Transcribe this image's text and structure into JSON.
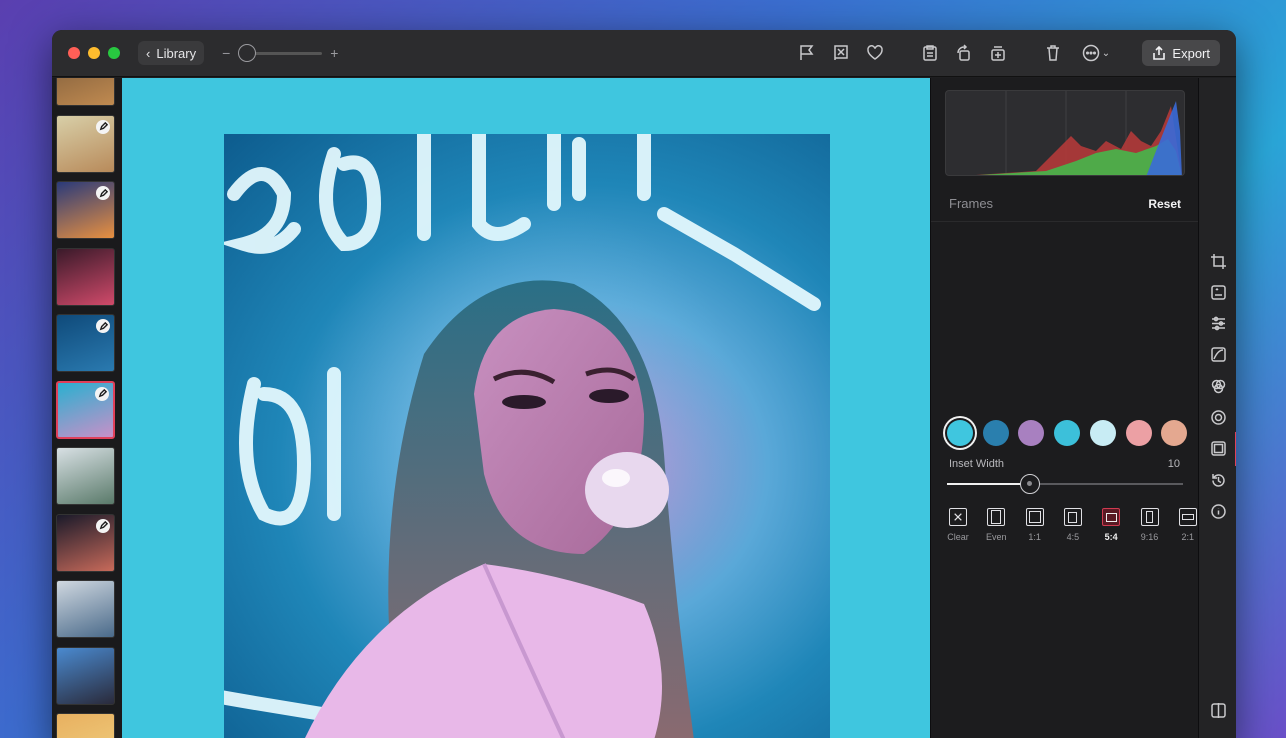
{
  "toolbar": {
    "back_label": "Library",
    "zoom_minus": "−",
    "zoom_plus": "+",
    "export_label": "Export",
    "icons": [
      "flag-icon",
      "reject-icon",
      "heart-icon",
      "clipboard-icon",
      "rotate-icon",
      "duplicate-icon",
      "trash-icon",
      "more-icon"
    ]
  },
  "filmstrip": {
    "thumbs": [
      {
        "colors": [
          "#7a5a3a",
          "#c08a50"
        ],
        "edited": false,
        "selected": false
      },
      {
        "colors": [
          "#d8cfa8",
          "#b88a5a"
        ],
        "edited": true,
        "selected": false
      },
      {
        "colors": [
          "#2a3a7a",
          "#e89040"
        ],
        "edited": true,
        "selected": false
      },
      {
        "colors": [
          "#3a1a2a",
          "#d04a6a"
        ],
        "edited": false,
        "selected": false
      },
      {
        "colors": [
          "#0f4a7a",
          "#2a7ab0"
        ],
        "edited": true,
        "selected": false
      },
      {
        "colors": [
          "#2ab0d0",
          "#c890c8"
        ],
        "edited": true,
        "selected": true
      },
      {
        "colors": [
          "#d8e0e4",
          "#5a7a6a"
        ],
        "edited": false,
        "selected": false
      },
      {
        "colors": [
          "#1a1a2a",
          "#c86a5a"
        ],
        "edited": true,
        "selected": false
      },
      {
        "colors": [
          "#d0d8e0",
          "#4a6a8a"
        ],
        "edited": false,
        "selected": false
      },
      {
        "colors": [
          "#4a8ad0",
          "#2a2a3a"
        ],
        "edited": false,
        "selected": false
      },
      {
        "colors": [
          "#e8b060",
          "#f0d080"
        ],
        "edited": false,
        "selected": false
      }
    ]
  },
  "canvas": {
    "background": "#3fc6df"
  },
  "inspector": {
    "section_title": "Frames",
    "reset_label": "Reset",
    "swatches": [
      "#3fc6df",
      "#2a7fae",
      "#a880c0",
      "#3cc0da",
      "#c8ecf4",
      "#eca0a4",
      "#e4a890"
    ],
    "selected_swatch": 0,
    "slider": {
      "label": "Inset Width",
      "value": "10",
      "fraction": 0.35
    },
    "ratios": [
      {
        "label": "Clear",
        "icon": "clear-frame-icon"
      },
      {
        "label": "Even",
        "icon": "even-frame-icon"
      },
      {
        "label": "1:1",
        "icon": "ratio-1-1-icon"
      },
      {
        "label": "4:5",
        "icon": "ratio-4-5-icon"
      },
      {
        "label": "5:4",
        "icon": "ratio-5-4-icon"
      },
      {
        "label": "9:16",
        "icon": "ratio-9-16-icon"
      },
      {
        "label": "2:1",
        "icon": "ratio-2-1-icon"
      }
    ],
    "selected_ratio": 4
  },
  "tools": [
    "crop-icon",
    "auto-enhance-icon",
    "adjust-icon",
    "curves-icon",
    "color-icon",
    "effects-icon",
    "frames-icon",
    "history-icon",
    "info-icon",
    "compare-icon"
  ],
  "active_tool": 6
}
